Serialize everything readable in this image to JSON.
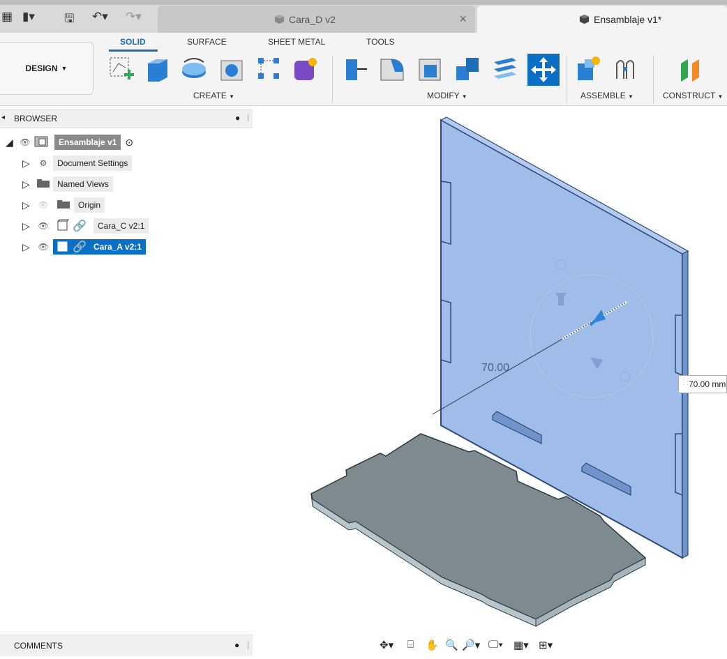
{
  "tabs": [
    {
      "label": "Cara_D v2",
      "active": false
    },
    {
      "label": "Ensamblaje v1*",
      "active": true
    }
  ],
  "tab_close": "×",
  "workspace": {
    "label": "DESIGN"
  },
  "toolbar_tabs": [
    "SOLID",
    "SURFACE",
    "SHEET METAL",
    "TOOLS"
  ],
  "groups": {
    "create": "CREATE",
    "modify": "MODIFY",
    "assemble": "ASSEMBLE",
    "construct": "CONSTRUCT"
  },
  "browser": {
    "title": "BROWSER",
    "root": "Ensamblaje v1",
    "items": [
      "Document Settings",
      "Named Views",
      "Origin",
      "Cara_C v2:1",
      "Cara_A v2:1"
    ]
  },
  "comments": {
    "title": "COMMENTS"
  },
  "dimension": {
    "label": "70.00",
    "input_value": "70.00 mm"
  },
  "colors": {
    "accent": "#0b6fc5",
    "panel_fill": "#8fb0e4",
    "base_fill": "#7d8a90"
  }
}
